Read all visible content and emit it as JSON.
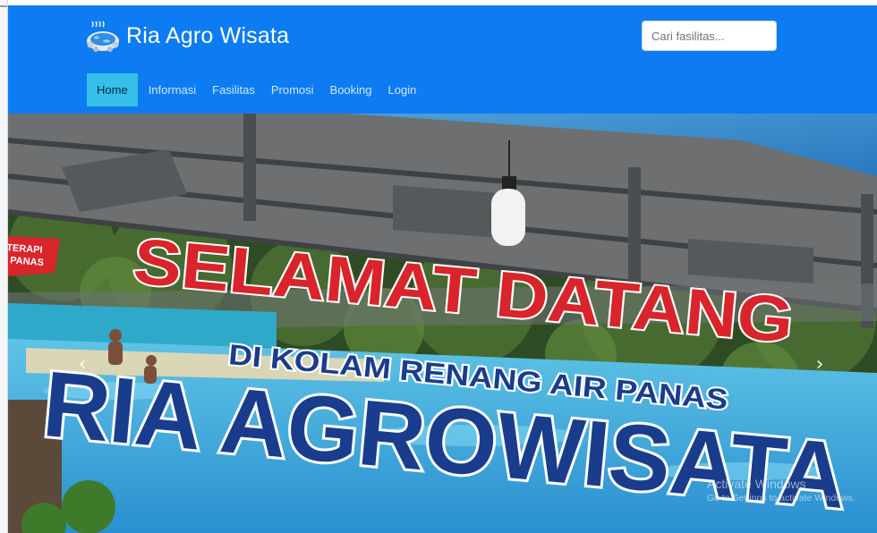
{
  "brand": {
    "title": "Ria Agro Wisata",
    "logo_icon": "hot-spring-icon"
  },
  "search": {
    "placeholder": "Cari fasilitas..."
  },
  "nav": {
    "items": [
      {
        "label": "Home",
        "active": true
      },
      {
        "label": "Informasi",
        "active": false
      },
      {
        "label": "Fasilitas",
        "active": false
      },
      {
        "label": "Promosi",
        "active": false
      },
      {
        "label": "Booking",
        "active": false
      },
      {
        "label": "Login",
        "active": false
      }
    ]
  },
  "hero": {
    "badge": [
      "TERAPI",
      "PANAS"
    ],
    "line1": "SELAMAT DATANG",
    "line2": "DI KOLAM RENANG AIR PANAS",
    "line3": "RIA AGROWISATA",
    "prev_icon": "chevron-left-icon",
    "next_icon": "chevron-right-icon"
  },
  "watermark": {
    "title": "Activate Windows",
    "subtitle": "Go to Settings to activate Windows."
  },
  "colors": {
    "navbar": "#0d7cf2",
    "nav_active": "#35bfe9",
    "sign_red": "#d8242a",
    "sign_navy": "#1a3c8c"
  }
}
